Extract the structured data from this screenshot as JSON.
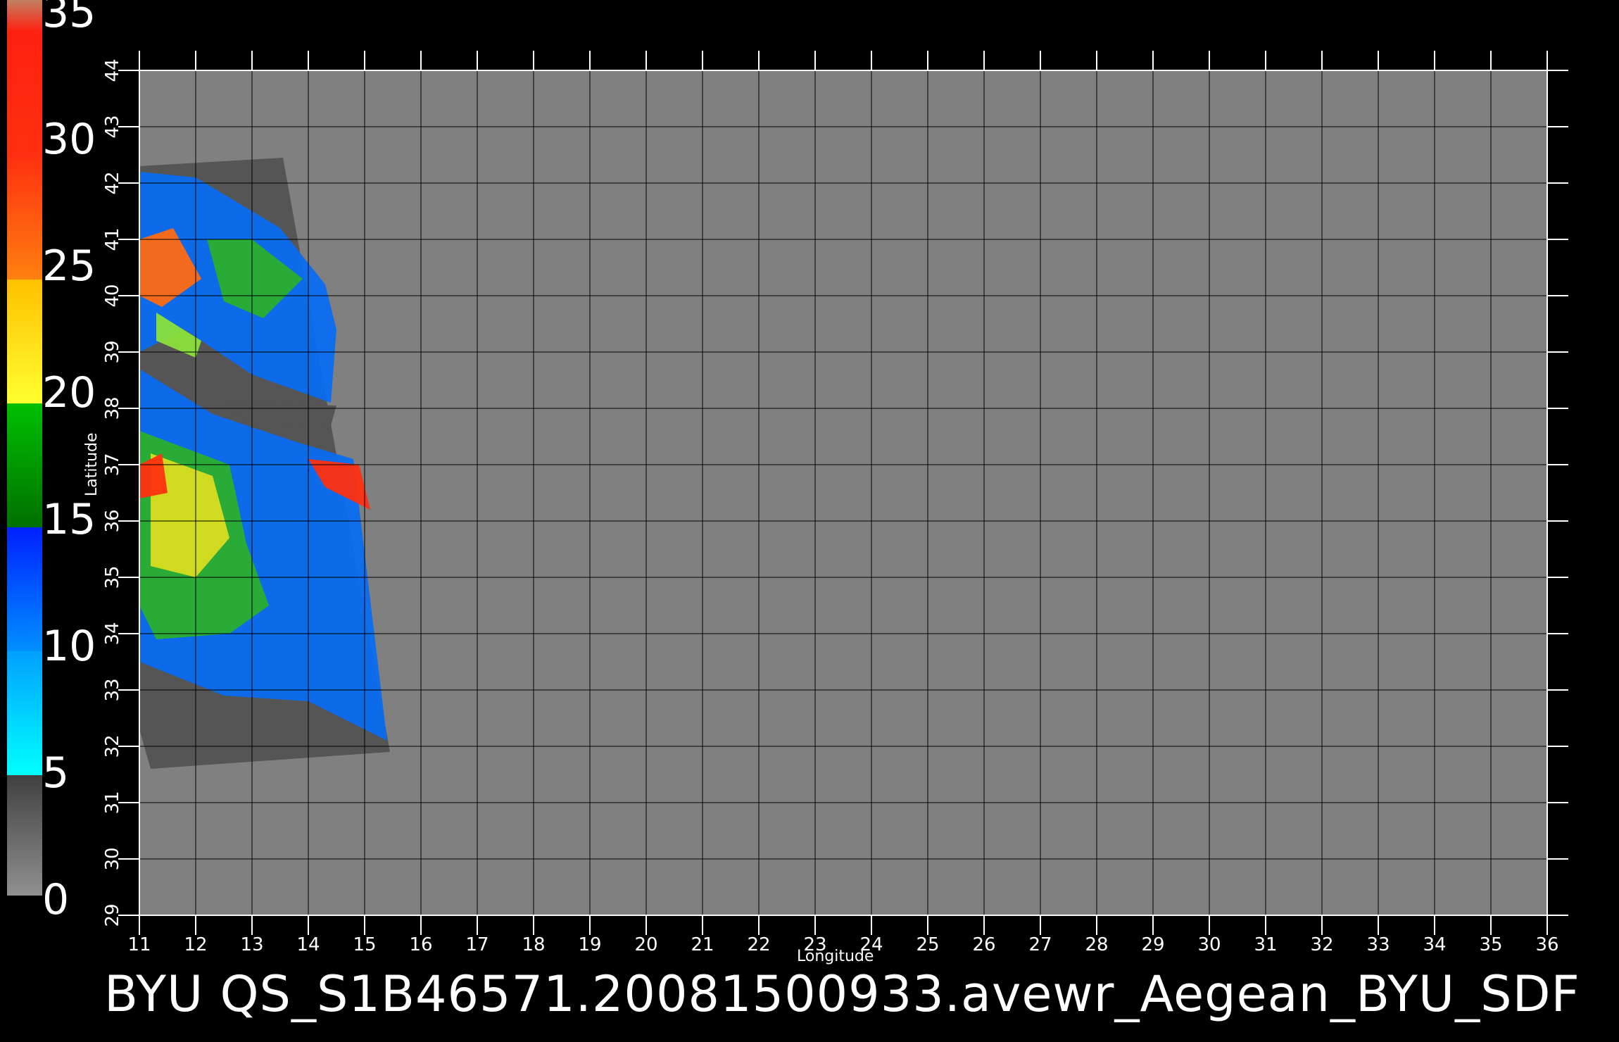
{
  "colorbar": {
    "labels": [
      "35",
      "30",
      "25",
      "20",
      "15",
      "10",
      "5",
      "0"
    ],
    "colors": [
      "#c08060",
      "#ff2010",
      "#ff5a10",
      "#ffc000",
      "#00b000",
      "#0050ff",
      "#00e8ff",
      "#808080"
    ]
  },
  "axes": {
    "xlabel": "Longitude",
    "ylabel": "Latitude",
    "x_ticks": [
      "11",
      "12",
      "13",
      "14",
      "15",
      "16",
      "17",
      "18",
      "19",
      "20",
      "21",
      "22",
      "23",
      "24",
      "25",
      "26",
      "27",
      "28",
      "29",
      "30",
      "31",
      "32",
      "33",
      "34",
      "35",
      "36"
    ],
    "y_ticks": [
      "29",
      "30",
      "31",
      "32",
      "33",
      "34",
      "35",
      "36",
      "37",
      "38",
      "39",
      "40",
      "41",
      "42",
      "43",
      "44"
    ],
    "xlim": [
      11,
      36
    ],
    "ylim": [
      29,
      44
    ]
  },
  "map": {
    "background_color": "#808080",
    "swath_color": "#555555",
    "grid_color": "#000000"
  },
  "title": "BYU  QS_S1B46571.20081500933.avewr_Aegean_BYU_SDF"
}
